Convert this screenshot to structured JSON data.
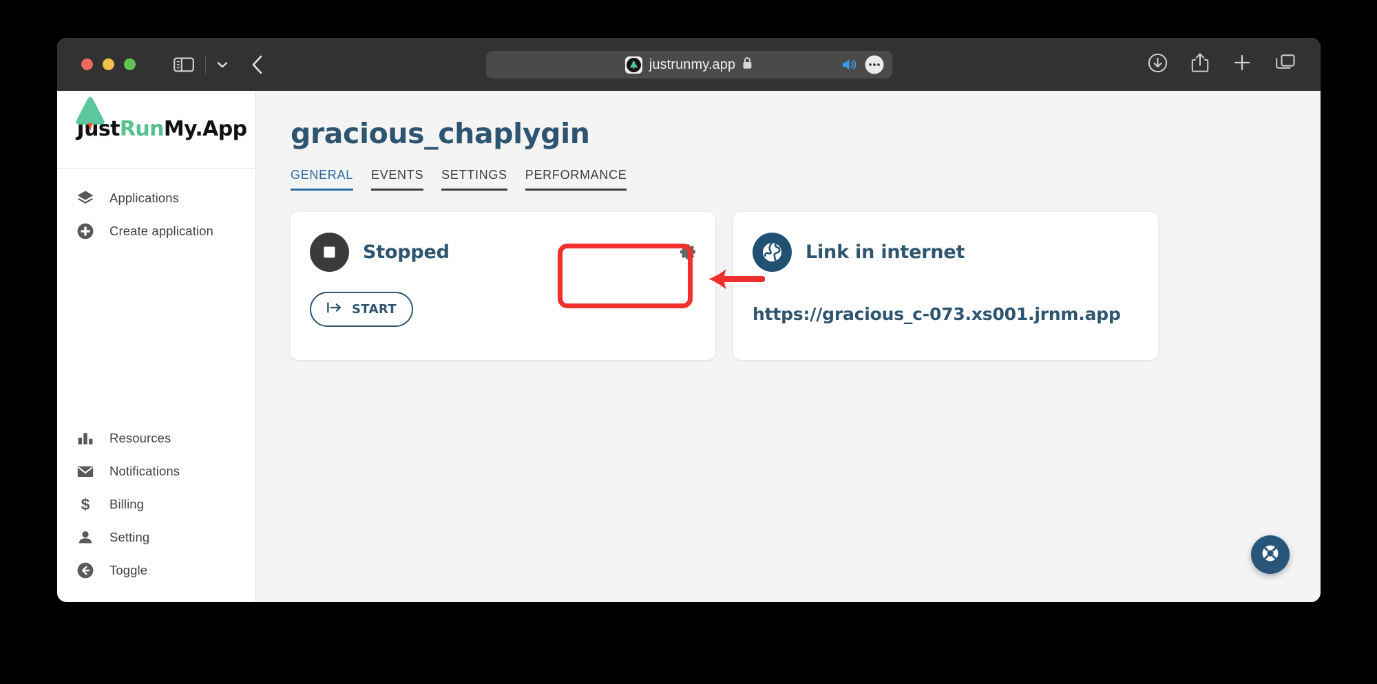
{
  "browser": {
    "url_text": "justrunmy.app",
    "favicon_name": "justrunmy-tree-favicon",
    "lock_icon": "lock-icon",
    "traffic_lights": [
      "close",
      "minimize",
      "zoom"
    ],
    "toolbar_icons": {
      "sidebar_toggle": "sidebar-toggle-icon",
      "tab_group_chevron": "chevron-down-icon",
      "back": "back-chevron-icon",
      "audio": "speaker-playing-icon",
      "page_menu": "more-ellipsis-icon",
      "downloads": "download-icon",
      "share": "share-icon",
      "new_tab": "plus-icon",
      "tab_overview": "tab-overview-icon"
    }
  },
  "sidebar": {
    "brand": {
      "text_part_1": "Just",
      "text_part_2": "Run",
      "text_part_3": "My.App",
      "accent_color": "#53c08d"
    },
    "top_items": [
      {
        "label": "Applications",
        "icon": "layers-icon"
      },
      {
        "label": "Create application",
        "icon": "plus-circle-icon"
      }
    ],
    "bottom_items": [
      {
        "label": "Resources",
        "icon": "bar-chart-icon"
      },
      {
        "label": "Notifications",
        "icon": "envelope-icon"
      },
      {
        "label": "Billing",
        "icon": "dollar-icon"
      },
      {
        "label": "Setting",
        "icon": "person-icon"
      },
      {
        "label": "Toggle",
        "icon": "arrow-left-circle-icon"
      }
    ]
  },
  "main": {
    "title": "gracious_chaplygin",
    "tabs": [
      {
        "label": "GENERAL",
        "active": true
      },
      {
        "label": "EVENTS",
        "active": false
      },
      {
        "label": "SETTINGS",
        "active": false
      },
      {
        "label": "PERFORMANCE",
        "active": false
      }
    ],
    "status_card": {
      "status": "Stopped",
      "status_icon": "stop-square-icon",
      "settings_icon": "gear-icon",
      "start_button_label": "START",
      "start_button_icon": "start-arrow-icon"
    },
    "link_card": {
      "title": "Link in internet",
      "icon": "globe-icon",
      "url": "https://gracious_c-073.xs001.jrnm.app"
    },
    "help_button_icon": "lifebuoy-icon",
    "annotation": {
      "highlight_color": "#f22f2f",
      "arrow_icon": "red-arrow-left"
    }
  }
}
